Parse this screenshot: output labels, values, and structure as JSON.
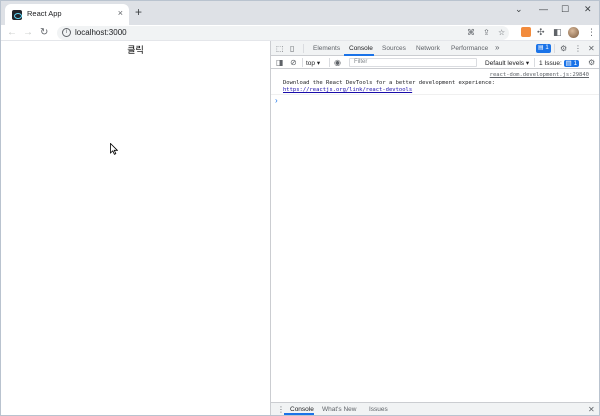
{
  "browser": {
    "tab_title": "React App",
    "tab_close": "×",
    "new_tab": "+",
    "url": "localhost:3000",
    "window_controls": {
      "dropdown": "⌄",
      "minimize": "—",
      "maximize": "☐",
      "close": "✕"
    }
  },
  "page": {
    "text": "클릭"
  },
  "devtools": {
    "tabs": [
      "Elements",
      "Console",
      "Sources",
      "Network",
      "Performance"
    ],
    "more_tabs": "»",
    "messages_badge": "1",
    "toolbar": {
      "context": "top",
      "filter_placeholder": "Filter",
      "levels": "Default levels",
      "issues_label": "1 Issue:",
      "issues_count": "1"
    },
    "console": {
      "source": "react-dom.development.js:29840",
      "message": "Download the React DevTools for a better development experience: ",
      "link": "https://reactjs.org/link/react-devtools",
      "prompt": "›"
    },
    "drawer": {
      "tabs": [
        "Console",
        "What's New",
        "Issues"
      ],
      "close": "✕"
    }
  },
  "colors": {
    "accent": "#1a73e8",
    "tabstrip": "#dee1e6",
    "devtools_header": "#f1f3f4"
  }
}
